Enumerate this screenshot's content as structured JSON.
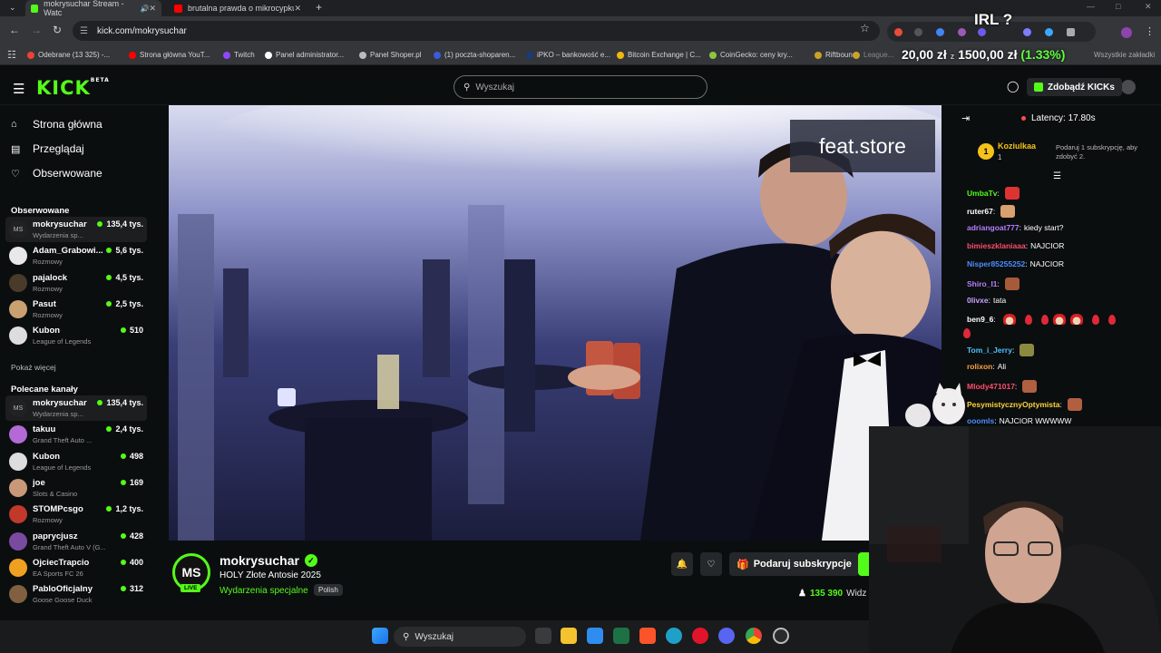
{
  "browser": {
    "tabs": [
      {
        "title": "mokrysuchar Stream - Watc",
        "active": true,
        "color": "#53fc18"
      },
      {
        "title": "brutalna prawda o mikrocypku",
        "active": false,
        "color": "#ff0000"
      }
    ],
    "url": "kick.com/mokrysuchar",
    "bookmarks": [
      {
        "label": "Odebrane (13 325) -...",
        "color": "#ea4335"
      },
      {
        "label": "Strona główna YouT...",
        "color": "#ff0000"
      },
      {
        "label": "Twitch",
        "color": "#9146ff"
      },
      {
        "label": "Panel administrator...",
        "color": "#ffffff"
      },
      {
        "label": "Panel Shoper.pl",
        "color": "#bbbbbb"
      },
      {
        "label": "(1) poczta-shoparen...",
        "color": "#3b5bdb"
      },
      {
        "label": "iPKO – bankowość e...",
        "color": "#1a3a7a"
      },
      {
        "label": "Bitcoin Exchange | C...",
        "color": "#f0b90b"
      },
      {
        "label": "CoinGecko: ceny kry...",
        "color": "#8dc63f"
      },
      {
        "label": "Riftbound",
        "color": "#c9a227"
      },
      {
        "label": "League...",
        "color": "#c9a227"
      },
      {
        "label": "Wszystkie zakładki",
        "color": "#888888"
      }
    ]
  },
  "overlay": {
    "irl": "IRL ?",
    "price1": "20,00 zł",
    "price2": "1500,00 zł",
    "change": "(1.33%)"
  },
  "header": {
    "logo": "KICK",
    "logo_sup": "BETA",
    "search_placeholder": "Wyszukaj",
    "kicks_button": "Zdobądź KICKs"
  },
  "sidebar": {
    "nav": [
      {
        "label": "Strona główna",
        "icon": "home-icon"
      },
      {
        "label": "Przeglądaj",
        "icon": "browse-icon"
      },
      {
        "label": "Obserwowane",
        "icon": "heart-icon"
      }
    ],
    "followed_title": "Obserwowane",
    "followed": [
      {
        "name": "mokrysuchar",
        "category": "Wydarzenia sp...",
        "viewers": "135,4 tys.",
        "avatar": "MS",
        "color": "#222"
      },
      {
        "name": "Adam_Grabowi...",
        "category": "Rozmowy",
        "viewers": "5,6 tys.",
        "avatar": "",
        "color": "#e8e8e8"
      },
      {
        "name": "pajalock",
        "category": "Rozmowy",
        "viewers": "4,5 tys.",
        "avatar": "",
        "color": "#4a3a2a"
      },
      {
        "name": "Pasut",
        "category": "Rozmowy",
        "viewers": "2,5 tys.",
        "avatar": "",
        "color": "#c9a070"
      },
      {
        "name": "Kubon",
        "category": "League of Legends",
        "viewers": "510",
        "avatar": "",
        "color": "#ddd"
      }
    ],
    "show_more": "Pokaż więcej",
    "recommended_title": "Polecane kanały",
    "recommended": [
      {
        "name": "mokrysuchar",
        "category": "Wydarzenia sp...",
        "viewers": "135,4 tys.",
        "avatar": "MS",
        "color": "#222"
      },
      {
        "name": "takuu",
        "category": "Grand Theft Auto ...",
        "viewers": "2,4 tys.",
        "avatar": "",
        "color": "#b36ad6"
      },
      {
        "name": "Kubon",
        "category": "League of Legends",
        "viewers": "498",
        "avatar": "",
        "color": "#ddd"
      },
      {
        "name": "joe",
        "category": "Slots & Casino",
        "viewers": "169",
        "avatar": "",
        "color": "#c89878"
      },
      {
        "name": "STOMPcsgo",
        "category": "Rozmowy",
        "viewers": "1,2 tys.",
        "avatar": "",
        "color": "#c0392b"
      },
      {
        "name": "paprycjusz",
        "category": "Grand Theft Auto V (G...",
        "viewers": "428",
        "avatar": "",
        "color": "#7a4aa0"
      },
      {
        "name": "OjciecTrapcio",
        "category": "EA Sports FC 26",
        "viewers": "400",
        "avatar": "",
        "color": "#f0a020"
      },
      {
        "name": "PabloOficjalny",
        "category": "Goose Goose Duck",
        "viewers": "312",
        "avatar": "",
        "color": "#806040"
      }
    ]
  },
  "video": {
    "sponsor": "feat.store"
  },
  "channel": {
    "avatar": "MS",
    "live": "LIVE",
    "name": "mokrysuchar",
    "title": "HOLY Złote Antosie 2025",
    "category": "Wydarzenia specjalne",
    "language": "Polish",
    "sub_button": "Podaruj subskrypcje",
    "viewers": "135 390",
    "viewers_suffix": "Widz"
  },
  "chat": {
    "latency": "Latency: 17.80s",
    "goal": {
      "rank": "1",
      "name": "Koziulkaa",
      "count": "1",
      "text": "Podaruj 1 subskrypcję, aby zdobyć 2."
    },
    "messages": [
      {
        "user": "UmbaTv",
        "text": "",
        "color": "#53fc18",
        "emote": "#d33"
      },
      {
        "user": "ruter67",
        "text": "",
        "color": "#ffffff",
        "emote": "#d9a070"
      },
      {
        "user": "adriangoat777",
        "text": "kiedy start?",
        "color": "#b77dff",
        "emote": ""
      },
      {
        "user": "bimieszklaniaaa",
        "text": "NAJCIOR",
        "color": "#ff4d6d",
        "emote": ""
      },
      {
        "user": "Nisper85255252",
        "text": "NAJCIOR",
        "color": "#4d8dff",
        "emote": ""
      },
      {
        "user": "Shiro_I1",
        "text": "",
        "color": "#b77dff",
        "emote": "#a65a3a"
      },
      {
        "user": "0livxe",
        "text": "tata",
        "color": "#c9a2ff",
        "emote": ""
      },
      {
        "user": "ben9_6",
        "text": "",
        "color": "#ffffff",
        "emote": ""
      },
      {
        "user": "Tom_i_Jerry",
        "text": "",
        "color": "#4dc3ff",
        "emote": "#8a8a40"
      },
      {
        "user": "rolixon",
        "text": "Ali",
        "color": "#ff9f43",
        "emote": ""
      },
      {
        "user": "Mlody471017",
        "text": "",
        "color": "#ff4d6d",
        "emote": "#b06040"
      },
      {
        "user": "PesymistycznyOptymista",
        "text": "",
        "color": "#ffd43b",
        "emote": "#b06040"
      },
      {
        "user": "ooomls",
        "text": "NAJCIOR WWWWW",
        "color": "#4d8dff",
        "emote": ""
      }
    ]
  },
  "taskbar": {
    "search": "Wyszukaj"
  }
}
